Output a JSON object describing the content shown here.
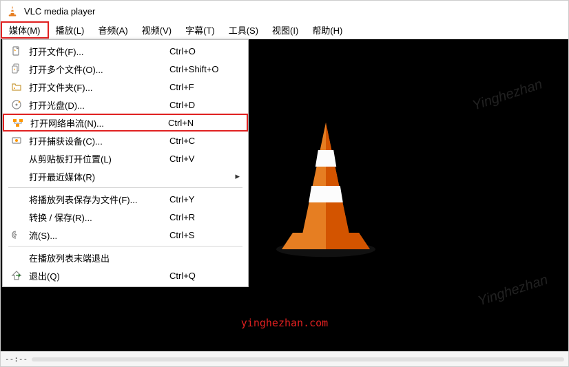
{
  "title": "VLC media player",
  "menubar": [
    "媒体(M)",
    "播放(L)",
    "音频(A)",
    "视频(V)",
    "字幕(T)",
    "工具(S)",
    "视图(I)",
    "帮助(H)"
  ],
  "active_menu_index": 0,
  "dropdown": [
    {
      "icon": "file",
      "label": "打开文件(F)...",
      "shortcut": "Ctrl+O"
    },
    {
      "icon": "files",
      "label": "打开多个文件(O)...",
      "shortcut": "Ctrl+Shift+O"
    },
    {
      "icon": "folder",
      "label": "打开文件夹(F)...",
      "shortcut": "Ctrl+F"
    },
    {
      "icon": "disc",
      "label": "打开光盘(D)...",
      "shortcut": "Ctrl+D"
    },
    {
      "icon": "network",
      "label": "打开网络串流(N)...",
      "shortcut": "Ctrl+N",
      "highlighted": true
    },
    {
      "icon": "capture",
      "label": "打开捕获设备(C)...",
      "shortcut": "Ctrl+C"
    },
    {
      "icon": "",
      "label": "从剪贴板打开位置(L)",
      "shortcut": "Ctrl+V"
    },
    {
      "icon": "",
      "label": "打开最近媒体(R)",
      "shortcut": "",
      "submenu": true
    },
    {
      "sep": true
    },
    {
      "icon": "",
      "label": "将播放列表保存为文件(F)...",
      "shortcut": "Ctrl+Y"
    },
    {
      "icon": "",
      "label": "转换 / 保存(R)...",
      "shortcut": "Ctrl+R"
    },
    {
      "icon": "stream",
      "label": "流(S)...",
      "shortcut": "Ctrl+S"
    },
    {
      "sep": true
    },
    {
      "icon": "",
      "label": "在播放列表末端退出",
      "shortcut": ""
    },
    {
      "icon": "quit",
      "label": "退出(Q)",
      "shortcut": "Ctrl+Q"
    }
  ],
  "watermark": "Yinghezhan",
  "watermark_url": "yinghezhan.com",
  "time": "--:--"
}
